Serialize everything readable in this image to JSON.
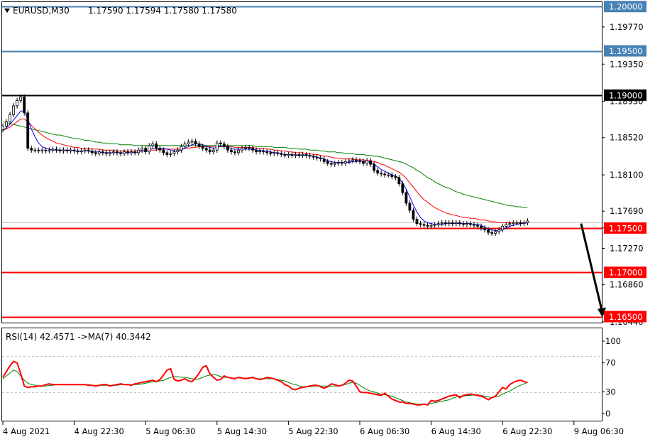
{
  "header": {
    "symbol_timeframe": "EURUSD,M30",
    "ohlc": "1.17590 1.17594 1.17580 1.17580"
  },
  "rsi_header": "RSI(14) 42.4571  ->MA(7) 40.3442",
  "colors": {
    "bull": "#ffffff",
    "bear": "#000000",
    "ma_fast": "#0000ff",
    "ma_mid": "#ff0000",
    "ma_slow": "#008000",
    "level_blue": "#4682b4",
    "level_black": "#000000",
    "level_red": "#ff0000",
    "rsi_line": "#ff0000",
    "rsi_ma": "#008000",
    "arrow": "#000000"
  },
  "chart_data": [
    {
      "type": "candlestick",
      "title": "EURUSD,M30",
      "y_ticks": [
        "1.19770",
        "1.19350",
        "1.18930",
        "1.18520",
        "1.18100",
        "1.17690",
        "1.17500",
        "1.17270",
        "1.16860",
        "1.16440"
      ],
      "ylim": [
        1.1644,
        1.2005
      ],
      "x_ticks": [
        "4 Aug 2021",
        "4 Aug 22:30",
        "5 Aug 06:30",
        "5 Aug 14:30",
        "5 Aug 22:30",
        "6 Aug 06:30",
        "6 Aug 14:30",
        "6 Aug 22:30",
        "9 Aug 06:30"
      ],
      "x_tick_index": [
        0,
        20,
        40,
        60,
        80,
        100,
        120,
        140,
        160
      ],
      "levels": [
        {
          "value": 1.2,
          "label": "1.20000",
          "style": "blue"
        },
        {
          "value": 1.195,
          "label": "1.19500",
          "style": "blue"
        },
        {
          "value": 1.19,
          "label": "1.19000",
          "style": "black"
        },
        {
          "value": 1.175,
          "label": "1.17500",
          "style": "red"
        },
        {
          "value": 1.17,
          "label": "1.17000",
          "style": "red"
        },
        {
          "value": 1.165,
          "label": "1.16500",
          "style": "red"
        }
      ],
      "projection_arrow": {
        "from_index": 162,
        "from": 1.1755,
        "to_index": 168,
        "to": 1.1649
      },
      "close": [
        1.1865,
        1.187,
        1.1878,
        1.1888,
        1.1894,
        1.1898,
        1.188,
        1.184,
        1.1838,
        1.1838,
        1.1837,
        1.1838,
        1.1837,
        1.1838,
        1.1839,
        1.1838,
        1.1837,
        1.1838,
        1.1837,
        1.1838,
        1.1837,
        1.1836,
        1.1837,
        1.1838,
        1.1837,
        1.1835,
        1.1834,
        1.1836,
        1.1835,
        1.1834,
        1.1835,
        1.1836,
        1.1835,
        1.1834,
        1.1836,
        1.1835,
        1.1836,
        1.1835,
        1.1838,
        1.184,
        1.1836,
        1.1843,
        1.1845,
        1.184,
        1.1838,
        1.1835,
        1.1833,
        1.1834,
        1.1836,
        1.1838,
        1.1842,
        1.1845,
        1.1847,
        1.1848,
        1.1845,
        1.1842,
        1.184,
        1.1838,
        1.1836,
        1.1838,
        1.1846,
        1.1845,
        1.1842,
        1.1838,
        1.1836,
        1.1835,
        1.1838,
        1.184,
        1.1841,
        1.184,
        1.1838,
        1.1836,
        1.1837,
        1.1836,
        1.1835,
        1.1834,
        1.1835,
        1.1834,
        1.1833,
        1.1832,
        1.1833,
        1.1832,
        1.1833,
        1.1832,
        1.1833,
        1.1832,
        1.1831,
        1.183,
        1.1829,
        1.1828,
        1.1825,
        1.1823,
        1.1822,
        1.1823,
        1.1824,
        1.1823,
        1.1825,
        1.1826,
        1.1827,
        1.1826,
        1.1825,
        1.1823,
        1.1826,
        1.1822,
        1.1815,
        1.1812,
        1.1811,
        1.181,
        1.181,
        1.1808,
        1.1807,
        1.18,
        1.179,
        1.1778,
        1.177,
        1.176,
        1.1755,
        1.1754,
        1.1753,
        1.1752,
        1.1753,
        1.1754,
        1.1755,
        1.1756,
        1.1755,
        1.1756,
        1.1755,
        1.1756,
        1.1755,
        1.1754,
        1.1755,
        1.1754,
        1.1753,
        1.1752,
        1.175,
        1.1748,
        1.1745,
        1.1744,
        1.1746,
        1.1748,
        1.1752,
        1.1754,
        1.1755,
        1.1756,
        1.1756,
        1.1755,
        1.1756,
        1.1758
      ],
      "ma_fast": [
        1.186,
        1.1863,
        1.1867,
        1.1872,
        1.1877,
        1.1882,
        1.1882,
        1.1873,
        1.1862,
        1.1853,
        1.1846,
        1.1842,
        1.184,
        1.1839,
        1.1838,
        1.1838,
        1.1838,
        1.1838,
        1.1838,
        1.1838,
        1.1837,
        1.1837,
        1.1837,
        1.1837,
        1.1837,
        1.1836,
        1.1836,
        1.1836,
        1.1835,
        1.1835,
        1.1835,
        1.1835,
        1.1835,
        1.1835,
        1.1835,
        1.1835,
        1.1835,
        1.1835,
        1.1836,
        1.1837,
        1.1837,
        1.1838,
        1.184,
        1.184,
        1.184,
        1.184,
        1.1839,
        1.1838,
        1.1837,
        1.1837,
        1.1838,
        1.184,
        1.1842,
        1.1844,
        1.1845,
        1.1845,
        1.1844,
        1.1842,
        1.1841,
        1.184,
        1.1841,
        1.1842,
        1.1842,
        1.1841,
        1.184,
        1.1839,
        1.1839,
        1.1839,
        1.1839,
        1.1839,
        1.1839,
        1.1838,
        1.1838,
        1.1837,
        1.1837,
        1.1836,
        1.1835,
        1.1835,
        1.1834,
        1.1833,
        1.1833,
        1.1833,
        1.1832,
        1.1832,
        1.1832,
        1.1832,
        1.1832,
        1.1831,
        1.183,
        1.1829,
        1.1828,
        1.1826,
        1.1825,
        1.1824,
        1.1824,
        1.1824,
        1.1824,
        1.1824,
        1.1825,
        1.1825,
        1.1826,
        1.1825,
        1.1825,
        1.1824,
        1.1822,
        1.1819,
        1.1816,
        1.1814,
        1.1812,
        1.181,
        1.1809,
        1.1806,
        1.1801,
        1.1794,
        1.1785,
        1.1776,
        1.1768,
        1.1762,
        1.1758,
        1.1756,
        1.1755,
        1.1754,
        1.1754,
        1.1754,
        1.1755,
        1.1755,
        1.1755,
        1.1755,
        1.1755,
        1.1755,
        1.1755,
        1.1755,
        1.1754,
        1.1754,
        1.1753,
        1.1751,
        1.1749,
        1.1748,
        1.1747,
        1.1747,
        1.1748,
        1.175,
        1.1752,
        1.1753,
        1.1754,
        1.1755,
        1.1755,
        1.1756
      ],
      "ma_mid": [
        1.186,
        1.1862,
        1.1864,
        1.1867,
        1.187,
        1.1873,
        1.1873,
        1.187,
        1.1866,
        1.1862,
        1.1858,
        1.1855,
        1.1852,
        1.185,
        1.1848,
        1.1846,
        1.1845,
        1.1844,
        1.1843,
        1.1842,
        1.1841,
        1.1841,
        1.184,
        1.184,
        1.184,
        1.1839,
        1.1839,
        1.1839,
        1.1838,
        1.1838,
        1.1838,
        1.1838,
        1.1837,
        1.1837,
        1.1837,
        1.1837,
        1.1837,
        1.1837,
        1.1837,
        1.1837,
        1.1837,
        1.1838,
        1.1838,
        1.1838,
        1.1839,
        1.1839,
        1.1839,
        1.1839,
        1.1839,
        1.1839,
        1.1839,
        1.184,
        1.184,
        1.1841,
        1.1841,
        1.1842,
        1.1842,
        1.1842,
        1.1842,
        1.1842,
        1.1842,
        1.1842,
        1.1842,
        1.1842,
        1.1842,
        1.1841,
        1.1841,
        1.1841,
        1.1841,
        1.1841,
        1.1841,
        1.184,
        1.184,
        1.184,
        1.1839,
        1.1839,
        1.1838,
        1.1838,
        1.1837,
        1.1837,
        1.1836,
        1.1836,
        1.1835,
        1.1835,
        1.1835,
        1.1834,
        1.1834,
        1.1833,
        1.1833,
        1.1832,
        1.1831,
        1.1831,
        1.183,
        1.1829,
        1.1829,
        1.1828,
        1.1828,
        1.1828,
        1.1828,
        1.1827,
        1.1827,
        1.1827,
        1.1826,
        1.1826,
        1.1825,
        1.1824,
        1.1822,
        1.1821,
        1.1819,
        1.1817,
        1.1815,
        1.1813,
        1.181,
        1.1806,
        1.1801,
        1.1796,
        1.1791,
        1.1786,
        1.1782,
        1.1779,
        1.1776,
        1.1773,
        1.1771,
        1.1769,
        1.1767,
        1.1766,
        1.1765,
        1.1764,
        1.1763,
        1.1762,
        1.1762,
        1.1761,
        1.1761,
        1.176,
        1.1759,
        1.1759,
        1.1758,
        1.1757,
        1.1757,
        1.1756,
        1.1756,
        1.1756,
        1.1756,
        1.1756,
        1.1756,
        1.1756,
        1.1756,
        1.1756
      ],
      "ma_slow": [
        1.187,
        1.1869,
        1.1868,
        1.1867,
        1.1866,
        1.1865,
        1.1864,
        1.1863,
        1.1862,
        1.1861,
        1.186,
        1.1859,
        1.1858,
        1.1857,
        1.1856,
        1.1855,
        1.1855,
        1.1854,
        1.1853,
        1.1852,
        1.1851,
        1.1851,
        1.185,
        1.1849,
        1.1849,
        1.1848,
        1.1847,
        1.1847,
        1.1846,
        1.1846,
        1.1845,
        1.1845,
        1.1845,
        1.1844,
        1.1844,
        1.1844,
        1.1844,
        1.1843,
        1.1843,
        1.1843,
        1.1843,
        1.1843,
        1.1843,
        1.1843,
        1.1843,
        1.1843,
        1.1843,
        1.1843,
        1.1843,
        1.1843,
        1.1843,
        1.1843,
        1.1843,
        1.1843,
        1.1843,
        1.1843,
        1.1843,
        1.1843,
        1.1843,
        1.1843,
        1.1843,
        1.1843,
        1.1843,
        1.1843,
        1.1843,
        1.1843,
        1.1843,
        1.1843,
        1.1843,
        1.1843,
        1.1843,
        1.1842,
        1.1842,
        1.1842,
        1.1842,
        1.1842,
        1.1841,
        1.1841,
        1.1841,
        1.1841,
        1.184,
        1.184,
        1.184,
        1.1839,
        1.1839,
        1.1839,
        1.1838,
        1.1838,
        1.1838,
        1.1837,
        1.1837,
        1.1836,
        1.1836,
        1.1836,
        1.1835,
        1.1835,
        1.1834,
        1.1834,
        1.1834,
        1.1833,
        1.1833,
        1.1833,
        1.1832,
        1.1832,
        1.1831,
        1.1831,
        1.183,
        1.1829,
        1.1828,
        1.1827,
        1.1826,
        1.1825,
        1.1824,
        1.1822,
        1.182,
        1.1818,
        1.1815,
        1.1813,
        1.181,
        1.1807,
        1.1805,
        1.1802,
        1.18,
        1.1798,
        1.1796,
        1.1795,
        1.1793,
        1.1791,
        1.179,
        1.1788,
        1.1787,
        1.1786,
        1.1785,
        1.1784,
        1.1783,
        1.1782,
        1.1781,
        1.178,
        1.1779,
        1.1778,
        1.1777,
        1.1776,
        1.1775,
        1.1775,
        1.1774,
        1.1774,
        1.1773,
        1.1773
      ]
    },
    {
      "type": "line",
      "title": "RSI(14) 42.4571  ->MA(7) 40.3442",
      "y_ticks": [
        "100",
        "70",
        "30",
        "0"
      ],
      "ylim": [
        0,
        100
      ],
      "levels": [
        70,
        30
      ],
      "series": [
        {
          "name": "RSI(14)",
          "color": "#ff0000",
          "values": [
            50,
            58,
            66,
            72,
            70,
            55,
            38,
            36,
            37,
            37,
            38,
            38,
            40,
            41,
            40,
            40,
            40,
            40,
            40,
            40,
            40,
            40,
            40,
            40,
            39,
            39,
            38,
            39,
            40,
            40,
            38,
            39,
            40,
            41,
            40,
            40,
            39,
            41,
            42,
            43,
            44,
            45,
            46,
            44,
            47,
            53,
            60,
            62,
            47,
            45,
            46,
            48,
            45,
            44,
            49,
            56,
            64,
            66,
            55,
            50,
            46,
            47,
            52,
            50,
            49,
            48,
            50,
            49,
            48,
            49,
            50,
            48,
            47,
            48,
            50,
            49,
            48,
            46,
            44,
            40,
            38,
            34,
            33,
            35,
            36,
            37,
            38,
            39,
            39,
            37,
            35,
            37,
            41,
            40,
            38,
            39,
            42,
            46,
            45,
            38,
            30,
            29,
            29,
            28,
            27,
            26,
            25,
            28,
            24,
            20,
            18,
            16,
            16,
            14,
            14,
            13,
            12,
            12,
            13,
            12,
            18,
            17,
            18,
            20,
            22,
            24,
            25,
            26,
            22,
            25,
            26,
            27,
            26,
            25,
            24,
            22,
            19,
            22,
            24,
            30,
            36,
            34,
            40,
            43,
            45,
            46,
            44,
            43
          ]
        },
        {
          "name": "MA(7)",
          "color": "#008000",
          "values": [
            48,
            52,
            56,
            60,
            58,
            52,
            46,
            42,
            40,
            39,
            38,
            38,
            38,
            39,
            39,
            40,
            40,
            40,
            40,
            40,
            40,
            40,
            40,
            40,
            40,
            39,
            39,
            39,
            39,
            39,
            39,
            39,
            39,
            40,
            40,
            40,
            40,
            40,
            40,
            41,
            42,
            43,
            44,
            44,
            45,
            46,
            48,
            50,
            51,
            51,
            50,
            50,
            49,
            48,
            47,
            48,
            50,
            52,
            53,
            54,
            53,
            51,
            50,
            50,
            49,
            49,
            49,
            49,
            49,
            49,
            49,
            48,
            48,
            48,
            48,
            48,
            48,
            47,
            46,
            45,
            43,
            41,
            40,
            38,
            37,
            37,
            37,
            38,
            38,
            38,
            38,
            38,
            38,
            38,
            38,
            39,
            40,
            42,
            43,
            42,
            39,
            36,
            33,
            31,
            30,
            28,
            27,
            26,
            25,
            24,
            22,
            20,
            18,
            16,
            15,
            14,
            13,
            13,
            13,
            13,
            14,
            15,
            16,
            17,
            18,
            19,
            21,
            23,
            24,
            24,
            25,
            25,
            26,
            26,
            25,
            24,
            23,
            22,
            23,
            24,
            27,
            29,
            31,
            34,
            37,
            39,
            41,
            43
          ]
        }
      ]
    }
  ]
}
